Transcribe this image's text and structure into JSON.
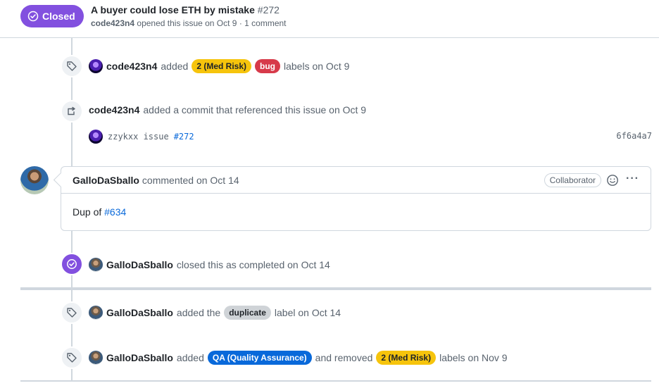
{
  "issue": {
    "state": "Closed",
    "title": "A buyer could lose ETH by mistake",
    "number": "#272",
    "author": "code423n4",
    "meta": "opened this issue on Oct 9 · 1 comment"
  },
  "events": {
    "labels_added": {
      "actor": "code423n4",
      "verb": "added",
      "labels": [
        "2 (Med Risk)",
        "bug"
      ],
      "suffix": "labels on Oct 9"
    },
    "commit_ref": {
      "actor": "code423n4",
      "text": "added a commit that referenced this issue on Oct 9",
      "commit_message": "zzykxx issue",
      "commit_ref": "#272",
      "sha": "6f6a4a7"
    },
    "comment": {
      "actor": "GalloDaSballo",
      "when": "commented on Oct 14",
      "role_badge": "Collaborator",
      "body_prefix": "Dup of",
      "body_link": "#634"
    },
    "closed": {
      "actor": "GalloDaSballo",
      "text": "closed this as completed on Oct 14"
    },
    "duplicate": {
      "actor": "GalloDaSballo",
      "verb": "added the",
      "label": "duplicate",
      "suffix": "label on Oct 14"
    },
    "relabel": {
      "actor": "GalloDaSballo",
      "verb": "added",
      "added_label": "QA (Quality Assurance)",
      "middle": "and removed",
      "removed_label": "2 (Med Risk)",
      "suffix": "labels on Nov 9"
    }
  },
  "colors": {
    "closed_purple": "#8250df",
    "med_risk_yellow": "#f6c40c",
    "bug_red": "#d73a4a",
    "qa_blue": "#0969da",
    "duplicate_grey": "#cfd3d7"
  },
  "icons": [
    "check-circle-icon",
    "tag-icon",
    "cross-reference-icon",
    "smiley-icon",
    "kebab-icon"
  ]
}
